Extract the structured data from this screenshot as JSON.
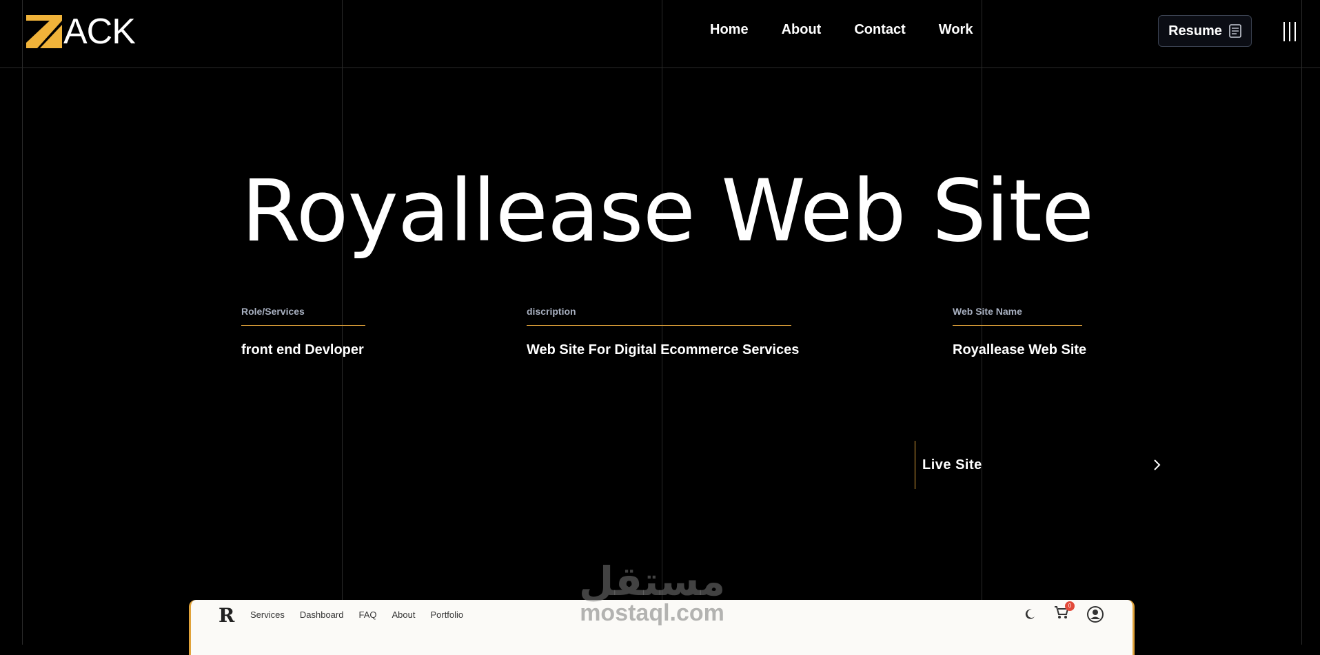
{
  "header": {
    "logo_text": "ACK",
    "nav": [
      "Home",
      "About",
      "Contact",
      "Work"
    ],
    "resume_label": "Resume"
  },
  "hero": {
    "title": "Royallease Web Site"
  },
  "details": [
    {
      "label": "Role/Services",
      "value": "front end Devloper"
    },
    {
      "label": "discription",
      "value": "Web Site For Digital Ecommerce Services"
    },
    {
      "label": "Web Site Name",
      "value": "Royallease Web Site"
    }
  ],
  "live_site": {
    "label": "Live Site"
  },
  "watermark": {
    "arabic": "مستقل",
    "latin": "mostaql.com"
  },
  "preview": {
    "nav": [
      "Services",
      "Dashboard",
      "FAQ",
      "About",
      "Portfolio"
    ],
    "cart_count": "0"
  },
  "colors": {
    "accent": "#e0a23a",
    "background": "#000000"
  }
}
